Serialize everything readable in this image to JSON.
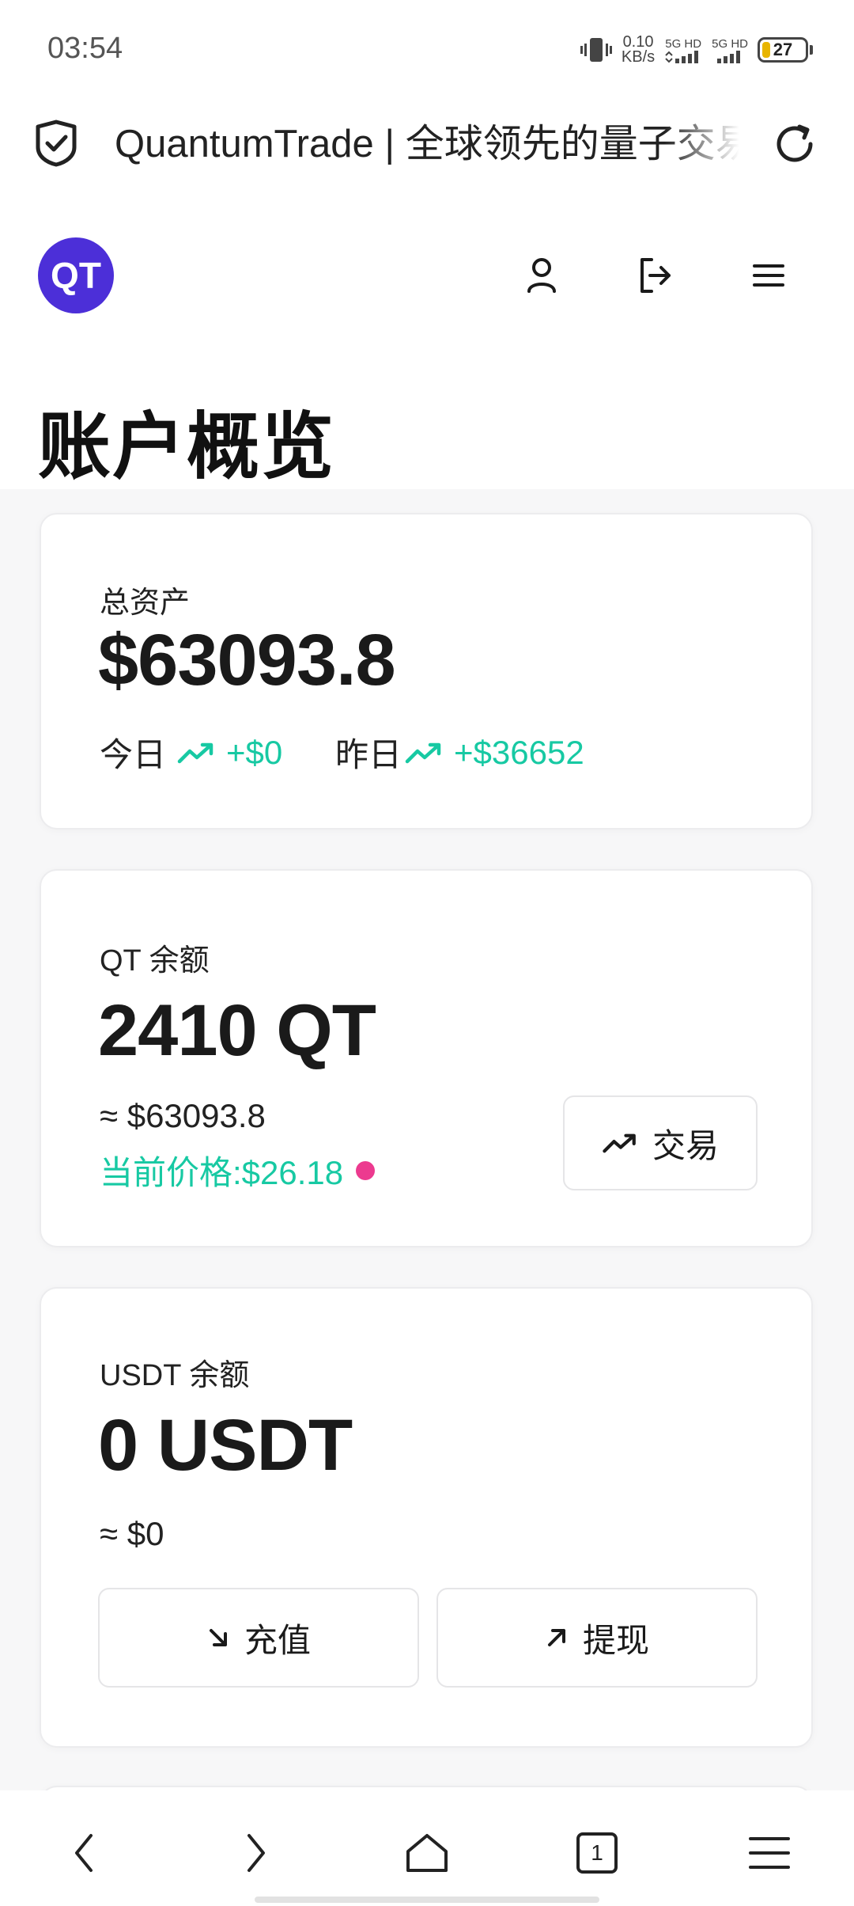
{
  "status_bar": {
    "time": "03:54",
    "net_speed_value": "0.10",
    "net_speed_unit": "KB/s",
    "sim1_label": "5G HD",
    "sim2_label": "5G HD",
    "battery_level": "27"
  },
  "browser": {
    "page_title": "QuantumTrade | 全球领先的量子交易平台"
  },
  "app": {
    "logo_text": "QT",
    "page_title": "账户概览"
  },
  "total_assets": {
    "label": "总资产",
    "value": "$63093.8",
    "today_label": "今日",
    "today_change": "+$0",
    "yesterday_label": "昨日",
    "yesterday_change": "+$36652"
  },
  "qt_balance": {
    "label": "QT 余额",
    "value": "2410 QT",
    "usd_equiv": "≈ $63093.8",
    "price_text": "当前价格:$26.18",
    "trade_button": "交易"
  },
  "usdt_balance": {
    "label": "USDT 余额",
    "value": "0 USDT",
    "usd_equiv": "≈ $0",
    "deposit_button": "充值",
    "withdraw_button": "提现"
  },
  "bottom_nav": {
    "tab_count": "1"
  },
  "colors": {
    "accent_green": "#17c9a3",
    "brand_purple": "#4c2fd8",
    "live_dot": "#ec3a8f"
  }
}
